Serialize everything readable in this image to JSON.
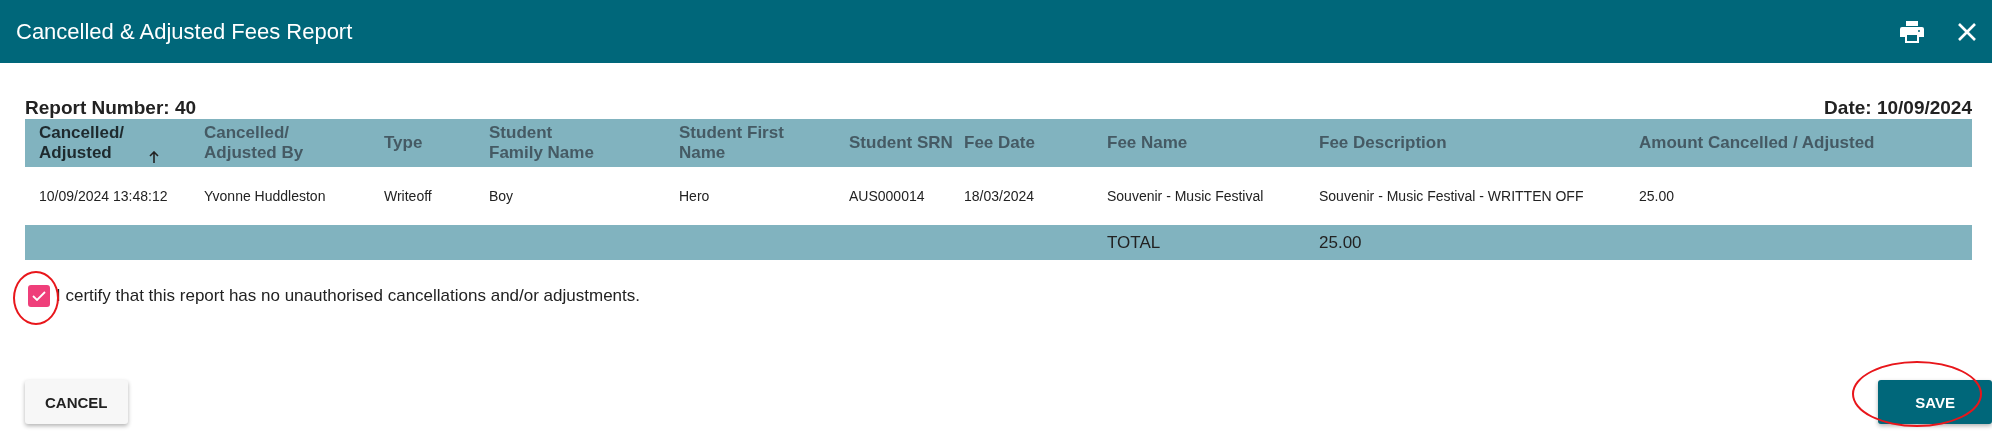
{
  "window": {
    "title": "Cancelled & Adjusted Fees Report"
  },
  "report_number": "Report Number: 40",
  "date": "Date: 10/09/2024",
  "table": {
    "columns": [
      {
        "label": "Cancelled/ Adjusted",
        "sorted": true
      },
      {
        "label": "Cancelled/ Adjusted By",
        "sorted": false
      },
      {
        "label": "Type",
        "sorted": false
      },
      {
        "label": "Student Family Name",
        "sorted": false
      },
      {
        "label": "Student First Name",
        "sorted": false
      },
      {
        "label": "Student SRN",
        "sorted": false
      },
      {
        "label": "Fee Date",
        "sorted": false
      },
      {
        "label": "Fee Name",
        "sorted": false
      },
      {
        "label": "Fee Description",
        "sorted": false
      },
      {
        "label": "Amount Cancelled / Adjusted",
        "sorted": false
      }
    ],
    "rows": [
      [
        "10/09/2024 13:48:12",
        "Yvonne Huddleston",
        "Writeoff",
        "Boy",
        "Hero",
        "AUS000014",
        "18/03/2024",
        "Souvenir - Music Festival",
        "Souvenir - Music Festival - WRITTEN OFF",
        "25.00"
      ]
    ],
    "total": {
      "label": "TOTAL",
      "value": "25.00"
    }
  },
  "certify": {
    "label": "I certify that this report has no unauthorised cancellations and/or adjustments.",
    "checked": true,
    "circled": true
  },
  "buttons": [
    {
      "label": "CANCEL",
      "kind": "secondary",
      "circled": false
    },
    {
      "label": "SAVE",
      "kind": "primary",
      "circled": true
    }
  ]
}
